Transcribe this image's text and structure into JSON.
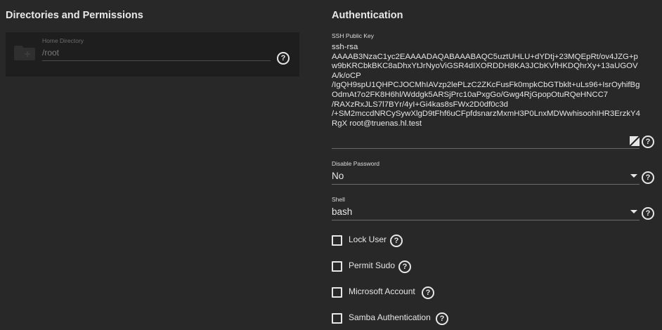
{
  "left": {
    "title": "Directories and Permissions",
    "home_directory": {
      "label": "Home Directory",
      "value": "/root"
    }
  },
  "right": {
    "title": "Authentication",
    "ssh_key": {
      "label": "SSH Public Key",
      "value": "ssh-rsa\nAAAAB3NzaC1yc2EAAAADAQABAAABAQC5uztUHLU+dYDtj+23MQEpRt/ov4JZG+pw9bKRCbkBKC8aDhxYtJrNyoViGSR4dIXORDDH8KA3JCbKVfHKDQhrXy+13aUGOVA/k/oCP\n/IgQH9spU1QHPCJOCMhIAVzp2lePLzC2ZKcFusFk0mpkCbGTbklt+uLs96+IsrOyhifBgOdmAt7o2FK8H6hl/Wddgk5ARSjPrc10aPxgGo/Gwg4RjGpopOtuRQeHNCC7\n/RAXzRxJLS7l7BYr/4yI+Gi4kas8sFWx2D0df0c3d\n/+SM2mccdNRCySywXlgD9tFhf6uCFpfdsnarzMxmH3P0LnxMDWwhisoohIHR3ErzkY4RgX root@truenas.hl.test"
    },
    "disable_password": {
      "label": "Disable Password",
      "value": "No"
    },
    "shell": {
      "label": "Shell",
      "value": "bash"
    },
    "checkboxes": [
      {
        "label": "Lock User",
        "checked": false
      },
      {
        "label": "Permit Sudo",
        "checked": false
      },
      {
        "label": "Microsoft Account",
        "checked": false
      },
      {
        "label": "Samba Authentication",
        "checked": false
      }
    ]
  },
  "icons": {
    "help": "help-circle-icon",
    "folder": "folder-icon",
    "caret": "arrow-drop-down-icon"
  },
  "colors": {
    "background": "#282828",
    "card": "#1e1e1e",
    "text": "#e6e6e6"
  }
}
